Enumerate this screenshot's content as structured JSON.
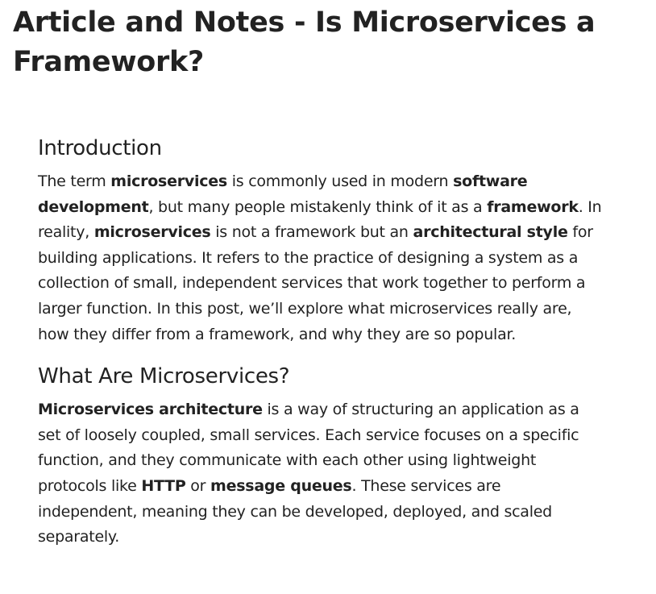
{
  "page_title": "Article and Notes - Is Microservices a Framework?",
  "sections": [
    {
      "heading": "Introduction",
      "paragraph": [
        {
          "text": "The term ",
          "bold": false
        },
        {
          "text": "microservices",
          "bold": true
        },
        {
          "text": " is commonly used in modern ",
          "bold": false
        },
        {
          "text": "software development",
          "bold": true
        },
        {
          "text": ", but many people mistakenly think of it as a ",
          "bold": false
        },
        {
          "text": "framework",
          "bold": true
        },
        {
          "text": ". In reality, ",
          "bold": false
        },
        {
          "text": "microservices",
          "bold": true
        },
        {
          "text": " is not a framework but an ",
          "bold": false
        },
        {
          "text": "architectural style",
          "bold": true
        },
        {
          "text": " for building applications. It refers to the practice of designing a system as a collection of small, independent services that work together to perform a larger function. In this post, we’ll explore what microservices really are, how they differ from a framework, and why they are so popular.",
          "bold": false
        }
      ]
    },
    {
      "heading": "What Are Microservices?",
      "paragraph": [
        {
          "text": "Microservices architecture",
          "bold": true
        },
        {
          "text": " is a way of structuring an application as a set of loosely coupled, small services. Each service focuses on a specific function, and they communicate with each other using lightweight protocols like ",
          "bold": false
        },
        {
          "text": "HTTP",
          "bold": true
        },
        {
          "text": " or ",
          "bold": false
        },
        {
          "text": "message queues",
          "bold": true
        },
        {
          "text": ". These services are independent, meaning they can be developed, deployed, and scaled separately.",
          "bold": false
        }
      ]
    }
  ]
}
